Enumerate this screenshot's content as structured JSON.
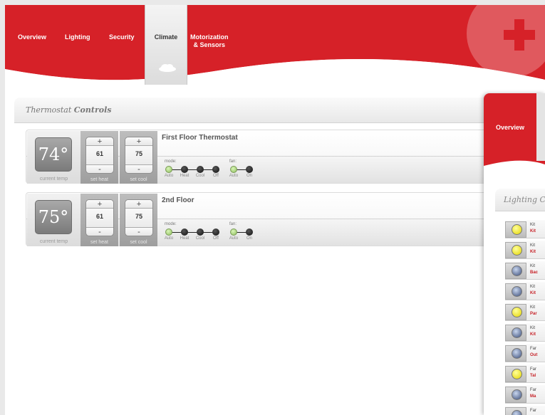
{
  "colors": {
    "brand_red": "#d62128",
    "active_tab": "#e8e8e8"
  },
  "nav": {
    "items": [
      {
        "label": "Overview"
      },
      {
        "label": "Lighting"
      },
      {
        "label": "Security"
      },
      {
        "label": "Climate",
        "active": true
      },
      {
        "label": "Motorization\n& Sensors"
      }
    ],
    "active_icon": "cloud-icon"
  },
  "panel": {
    "title_italic": "Thermostat",
    "title_bold": "Controls"
  },
  "thermostats": [
    {
      "name": "First Floor Thermostat",
      "current_temp": "74°",
      "current_label": "current temp",
      "set_heat": "61",
      "set_heat_label": "set heat",
      "set_cool": "75",
      "set_cool_label": "set cool",
      "plus": "+",
      "minus": "-",
      "mode_label": "mode:",
      "mode_options": [
        "Auto",
        "Heat",
        "Cool",
        "Off"
      ],
      "mode_selected": "Auto",
      "fan_label": "fan:",
      "fan_options": [
        "Auto",
        "On"
      ],
      "fan_selected": "Auto"
    },
    {
      "name": "2nd Floor",
      "current_temp": "75°",
      "current_label": "current temp",
      "set_heat": "61",
      "set_heat_label": "set heat",
      "set_cool": "75",
      "set_cool_label": "set cool",
      "plus": "+",
      "minus": "-",
      "mode_label": "mode:",
      "mode_options": [
        "Auto",
        "Heat",
        "Cool",
        "Off"
      ],
      "mode_selected": "Auto",
      "fan_label": "fan:",
      "fan_options": [
        "Auto",
        "On"
      ],
      "fan_selected": "Auto"
    }
  ],
  "second_window": {
    "nav_label": "Overview",
    "panel_title_italic": "Lighting C",
    "lights": [
      {
        "room": "Kit",
        "name": "Kit",
        "state": "on"
      },
      {
        "room": "Kit",
        "name": "Kit",
        "state": "on"
      },
      {
        "room": "Kit",
        "name": "Bac",
        "state": "off"
      },
      {
        "room": "Kit",
        "name": "Kit",
        "state": "off"
      },
      {
        "room": "Kit",
        "name": "Par",
        "state": "on"
      },
      {
        "room": "Kit",
        "name": "Kit",
        "state": "off"
      },
      {
        "room": "Far",
        "name": "Out",
        "state": "off"
      },
      {
        "room": "Far",
        "name": "Tal",
        "state": "on"
      },
      {
        "room": "Far",
        "name": "Ma",
        "state": "off"
      },
      {
        "room": "Far",
        "name": "Far",
        "state": "off"
      }
    ]
  }
}
